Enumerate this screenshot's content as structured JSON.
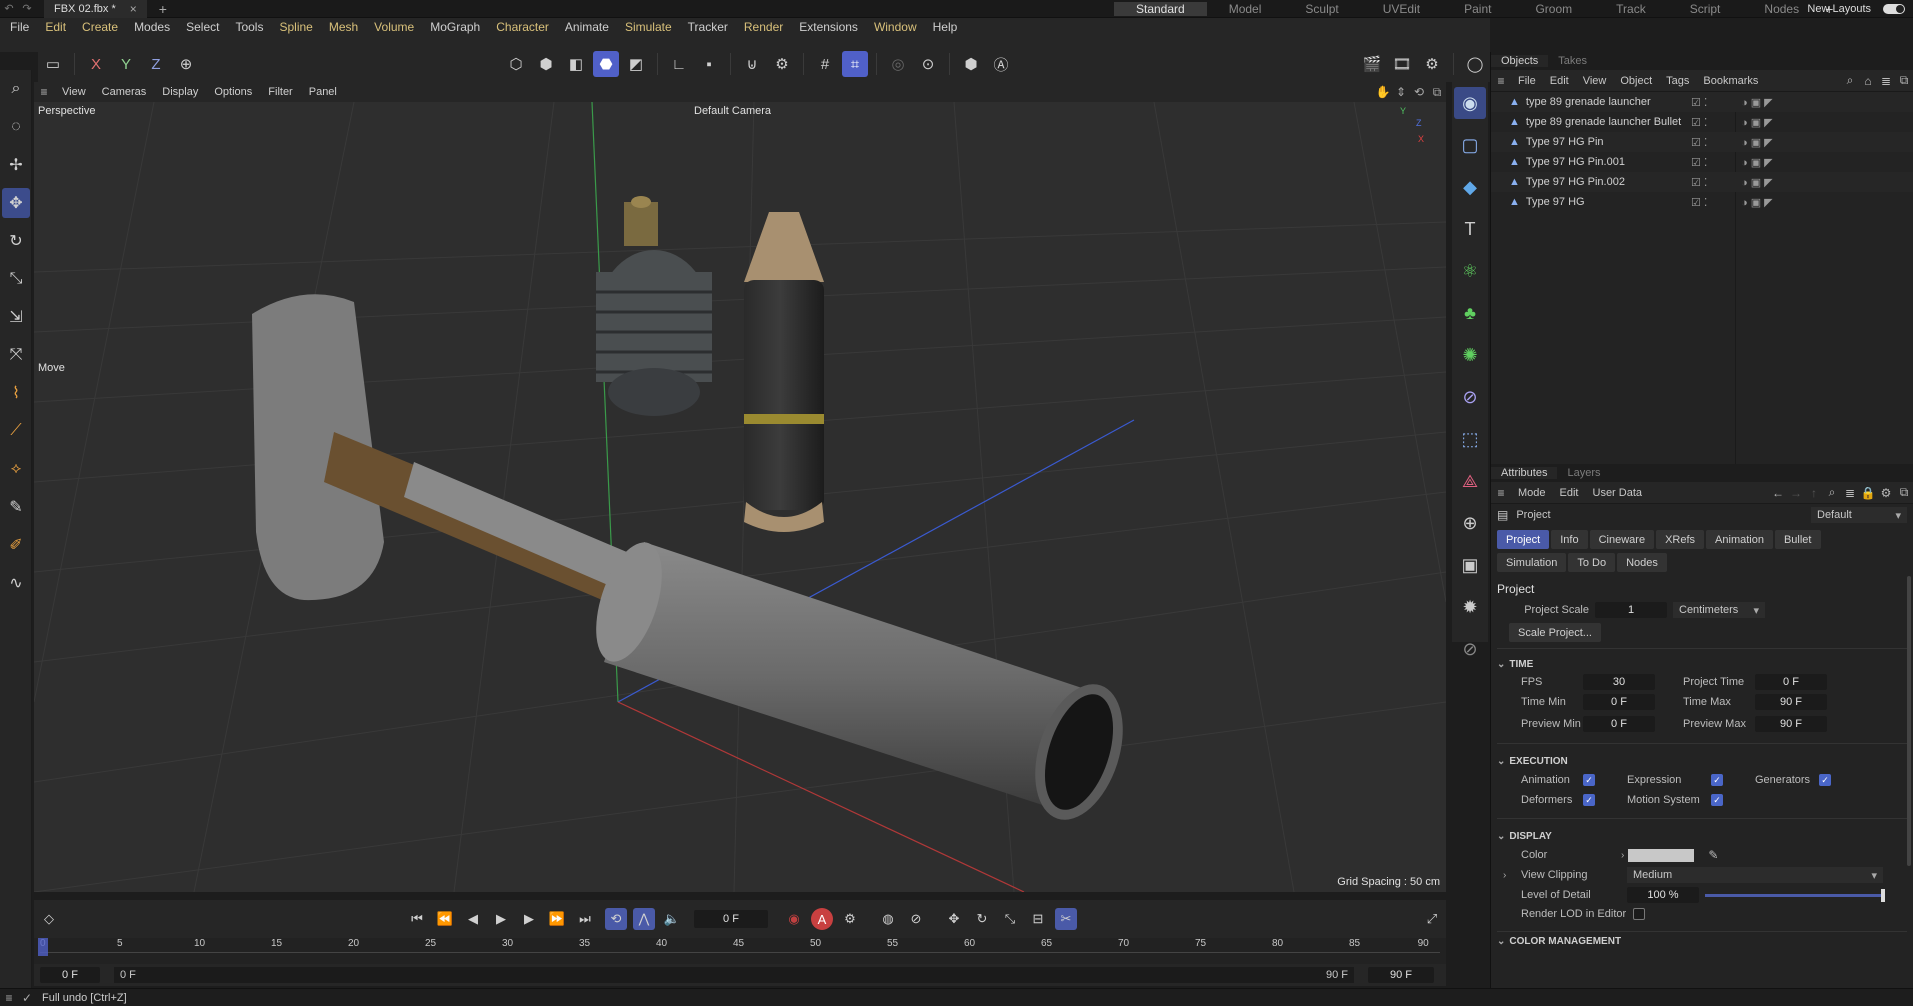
{
  "titlebar": {
    "doc_tab": "FBX 02.fbx *",
    "close_glyph": "×",
    "add_glyph": "+",
    "new_layouts": "New Layouts"
  },
  "menubar": {
    "items": [
      "File",
      "Edit",
      "Create",
      "Modes",
      "Select",
      "Tools",
      "Spline",
      "Mesh",
      "Volume",
      "MoGraph",
      "Character",
      "Animate",
      "Simulate",
      "Tracker",
      "Render",
      "Extensions",
      "Window",
      "Help"
    ]
  },
  "layout_tabs": {
    "items": [
      "Standard",
      "Model",
      "Sculpt",
      "UVEdit",
      "Paint",
      "Groom",
      "Track",
      "Script",
      "Nodes"
    ],
    "active": "Standard",
    "add": "+"
  },
  "toolbar": {
    "axis_x": "X",
    "axis_y": "Y",
    "axis_z": "Z"
  },
  "viewport": {
    "menu": [
      "View",
      "Cameras",
      "Display",
      "Options",
      "Filter",
      "Panel"
    ],
    "projection_label": "Perspective",
    "camera_label": "Default Camera",
    "tool_label": "Move",
    "grid_spacing": "Grid Spacing : 50 cm",
    "axis_gizmo": {
      "y": "Y",
      "z": "Z",
      "x": "X"
    }
  },
  "objects": {
    "tabs": [
      "Objects",
      "Takes"
    ],
    "menu": [
      "File",
      "Edit",
      "View",
      "Object",
      "Tags",
      "Bookmarks"
    ],
    "rows": [
      {
        "name": "type 89 grenade launcher"
      },
      {
        "name": "type 89 grenade launcher Bullet"
      },
      {
        "name": "Type 97 HG Pin"
      },
      {
        "name": "Type 97 HG Pin.001"
      },
      {
        "name": "Type 97 HG Pin.002"
      },
      {
        "name": "Type 97 HG"
      }
    ]
  },
  "attributes": {
    "tabs": [
      "Attributes",
      "Layers"
    ],
    "menu": [
      "Mode",
      "Edit",
      "User Data"
    ],
    "object_label": "Project",
    "preset": "Default",
    "chips_row1": [
      "Project",
      "Info",
      "Cineware",
      "XRefs",
      "Animation",
      "Bullet"
    ],
    "chips_row2": [
      "Simulation",
      "To Do",
      "Nodes"
    ],
    "active_chip": "Project",
    "section_title": "Project",
    "project_scale_label": "Project Scale",
    "project_scale_value": "1",
    "project_scale_unit": "Centimeters",
    "scale_project_button": "Scale Project...",
    "time": {
      "header": "TIME",
      "fps_label": "FPS",
      "fps": "30",
      "project_time_label": "Project Time",
      "project_time": "0 F",
      "time_min_label": "Time Min",
      "time_min": "0 F",
      "time_max_label": "Time Max",
      "time_max": "90 F",
      "preview_min_label": "Preview Min",
      "preview_min": "0 F",
      "preview_max_label": "Preview Max",
      "preview_max": "90 F"
    },
    "execution": {
      "header": "EXECUTION",
      "animation": "Animation",
      "expression": "Expression",
      "generators": "Generators",
      "deformers": "Deformers",
      "motion_system": "Motion System",
      "check_glyph": "✓"
    },
    "display": {
      "header": "DISPLAY",
      "color_label": "Color",
      "color_value": "#c8c8c8",
      "view_clipping_label": "View Clipping",
      "view_clipping_value": "Medium",
      "lod_label": "Level of Detail",
      "lod_value": "100 %",
      "render_lod_label": "Render LOD in Editor"
    },
    "color_management_header": "COLOR MANAGEMENT"
  },
  "timeline": {
    "current_frame": "0 F",
    "ticks": [
      "0",
      "5",
      "10",
      "15",
      "20",
      "25",
      "30",
      "35",
      "40",
      "45",
      "50",
      "55",
      "60",
      "65",
      "70",
      "75",
      "80",
      "85",
      "90"
    ],
    "start_field": "0 F",
    "range_start": "0 F",
    "range_end": "90 F",
    "end_field": "90 F",
    "record_glyph": "A"
  },
  "status": {
    "message": "Full undo [Ctrl+Z]"
  },
  "colors": {
    "accent": "#4a5aa8",
    "axis_x": "#c04040",
    "axis_y": "#40c060",
    "axis_z": "#4060e0",
    "menu_highlight": "#d8c07a"
  }
}
